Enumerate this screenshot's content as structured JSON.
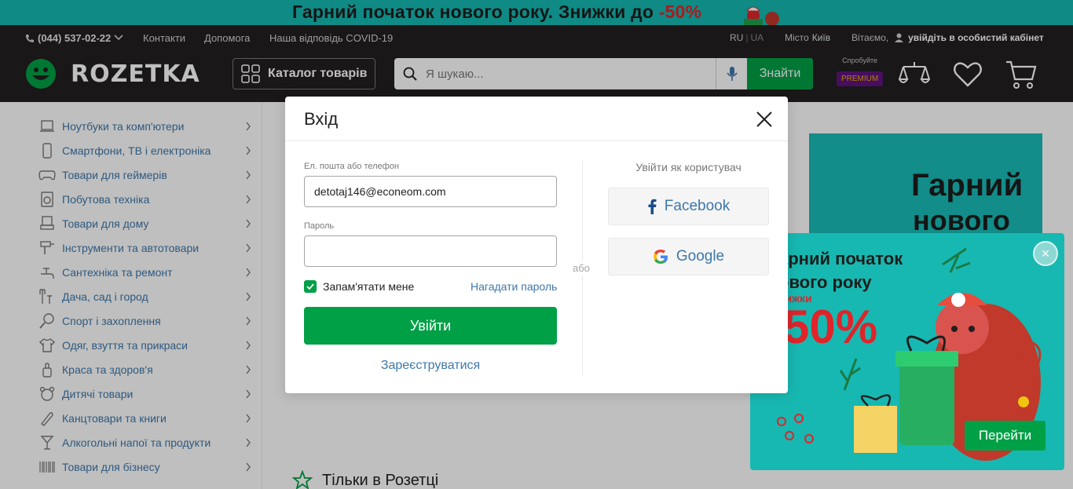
{
  "promo_banner": {
    "text": "Гарний початок нового року. Знижки до ",
    "discount": "-50%",
    "bg_color": "#15b8b2"
  },
  "topbar": {
    "phone": "(044) 537-02-22",
    "links": [
      "Контакти",
      "Допомога",
      "Наша відповідь COVID-19"
    ],
    "lang_ru": "RU",
    "lang_sep": "|",
    "lang_ua": "UA",
    "city_label": "Місто",
    "city_value": "Київ",
    "greeting": "Вітаємо,",
    "login_link": "увійдіть в особистий кабінет"
  },
  "header": {
    "logo_text": "ROZETKA",
    "catalog_label": "Каталог товарів",
    "search_placeholder": "Я шукаю...",
    "search_button": "Знайти",
    "premium_try": "Спробуйте",
    "premium_badge": "PREMIUM",
    "icons": [
      "compare-icon",
      "heart-icon",
      "cart-icon"
    ]
  },
  "sidebar": {
    "items": [
      {
        "label": "Ноутбуки та комп'ютери",
        "icon": "laptop-icon"
      },
      {
        "label": "Смартфони, ТВ і електроніка",
        "icon": "smartphone-icon"
      },
      {
        "label": "Товари для геймерів",
        "icon": "gamepad-icon"
      },
      {
        "label": "Побутова техніка",
        "icon": "washing-machine-icon"
      },
      {
        "label": "Товари для дому",
        "icon": "armchair-icon"
      },
      {
        "label": "Інструменти та автотовари",
        "icon": "tools-icon"
      },
      {
        "label": "Сантехніка та ремонт",
        "icon": "faucet-icon"
      },
      {
        "label": "Дача, сад і город",
        "icon": "garden-icon"
      },
      {
        "label": "Спорт і захоплення",
        "icon": "sport-icon"
      },
      {
        "label": "Одяг, взуття та прикраси",
        "icon": "tshirt-icon"
      },
      {
        "label": "Краса та здоров'я",
        "icon": "beauty-icon"
      },
      {
        "label": "Дитячі товари",
        "icon": "baby-icon"
      },
      {
        "label": "Канцтовари та книги",
        "icon": "pencil-icon"
      },
      {
        "label": "Алкогольні напої та продукти",
        "icon": "glass-icon"
      },
      {
        "label": "Товари для бізнесу",
        "icon": "barcode-icon"
      }
    ]
  },
  "hero": {
    "line1": "Гарний",
    "line2": "нового"
  },
  "section": {
    "title": "Тільки в Розетці"
  },
  "popup": {
    "line1": "арний початок",
    "line2": "ового року",
    "sale": "нижки",
    "percent": "50%",
    "button": "Перейти"
  },
  "modal": {
    "title": "Вхід",
    "email_label": "Ел. пошта або телефон",
    "email_value": "detotaj146@econeom.com",
    "password_label": "Пароль",
    "password_value": "",
    "remember_label": "Запам'ятати мене",
    "remember_checked": true,
    "forgot_label": "Нагадати пароль",
    "login_button": "Увійти",
    "register_link": "Зареєструватися",
    "or_label": "або",
    "social_title": "Увійти як користувач",
    "facebook_label": "Facebook",
    "google_label": "Google"
  },
  "colors": {
    "header_bg": "#221f1f",
    "accent_green": "#00a046",
    "link_blue": "#3e77aa",
    "premium_purple": "#5f137c"
  }
}
